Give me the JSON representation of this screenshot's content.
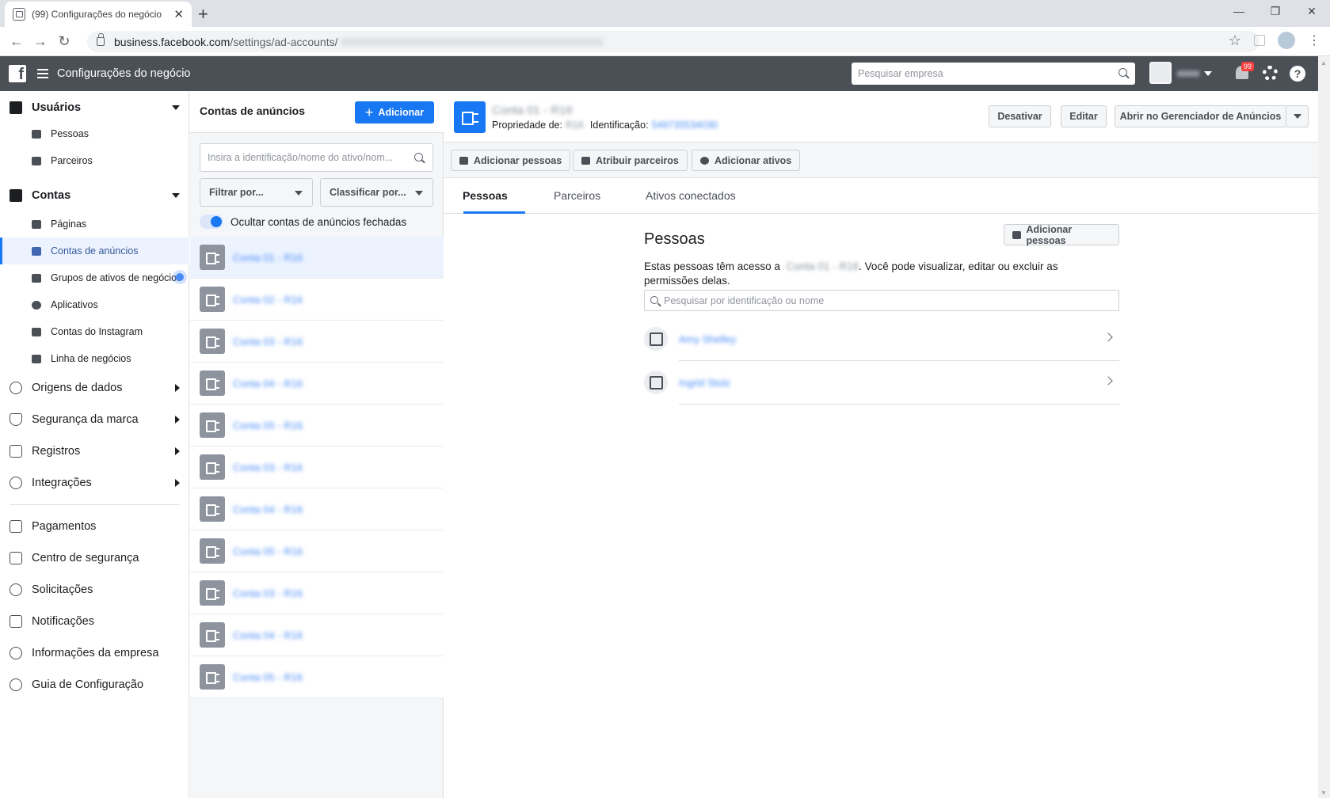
{
  "browser": {
    "tab_title": "(99) Configurações do negócio",
    "new_tab": "+",
    "url_host": "business.facebook.com",
    "url_path": "/settings/ad-accounts/",
    "win_min": "—",
    "win_max": "❐",
    "win_close": "✕"
  },
  "topbar": {
    "title": "Configurações do negócio",
    "search_placeholder": "Pesquisar empresa",
    "notification_count": "99",
    "help": "?"
  },
  "sidebar": {
    "users": {
      "label": "Usuários",
      "items": [
        "Pessoas",
        "Parceiros"
      ]
    },
    "accounts": {
      "label": "Contas",
      "items": [
        "Páginas",
        "Contas de anúncios",
        "Grupos de ativos de negócios",
        "Aplicativos",
        "Contas do Instagram",
        "Linha de negócios"
      ]
    },
    "collapsed": [
      "Origens de dados",
      "Segurança da marca",
      "Registros",
      "Integrações"
    ],
    "bottom": [
      "Pagamentos",
      "Centro de segurança",
      "Solicitações",
      "Notificações",
      "Informações da empresa",
      "Guia de Configuração"
    ]
  },
  "list": {
    "title": "Contas de anúncios",
    "add_label": "Adicionar",
    "search_placeholder": "Insira a identificação/nome do ativo/nom...",
    "filter_label": "Filtrar por...",
    "sort_label": "Classificar por...",
    "toggle_label": "Ocultar contas de anúncios fechadas",
    "accounts": [
      "Conta 01 - R16",
      "Conta 02 - R16",
      "Conta 03 - R16",
      "Conta 04 - R16",
      "Conta 05 - R16",
      "Conta 03 - R16",
      "Conta 04 - R16",
      "Conta 05 - R16",
      "Conta 03 - R16",
      "Conta 04 - R16",
      "Conta 05 - R16"
    ]
  },
  "detail": {
    "name": "Conta 01 - R16",
    "owner_label": "Propriedade de:",
    "owner_value": "R16",
    "id_label": "Identificação:",
    "id_value": "549735534030",
    "deactivate_label": "Desativar",
    "edit_label": "Editar",
    "open_ads_manager_label": "Abrir no Gerenciador de Anúncios",
    "actions": [
      "Adicionar pessoas",
      "Atribuir parceiros",
      "Adicionar ativos"
    ],
    "tabs": [
      "Pessoas",
      "Parceiros",
      "Ativos conectados"
    ]
  },
  "people": {
    "title": "Pessoas",
    "add_label": "Adicionar pessoas",
    "desc_before": "Estas pessoas têm acesso a",
    "desc_account": "Conta 01 - R16",
    "desc_after": ". Você pode visualizar, editar ou excluir as permissões delas.",
    "search_placeholder": "Pesquisar por identificação ou nome",
    "rows": [
      "Amy Shelley",
      "Ingrid Stolz"
    ]
  }
}
